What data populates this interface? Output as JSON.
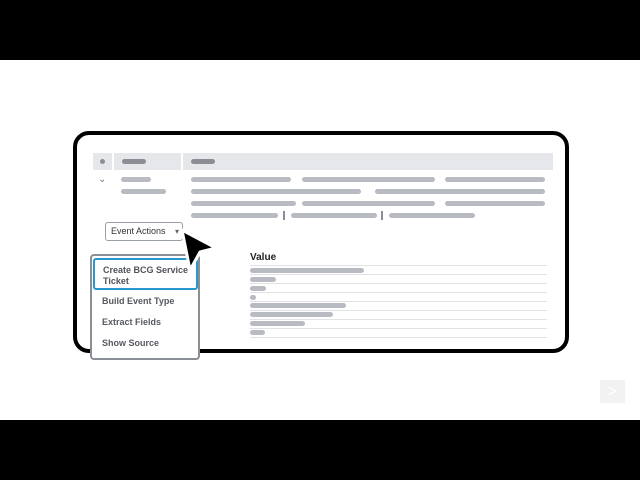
{
  "event_actions": {
    "label": "Event Actions",
    "caret_icon": "caret-down-icon"
  },
  "fields_table": {
    "value_header": "Value"
  },
  "menu": {
    "items": [
      {
        "label": "Create BCG Service Ticket",
        "highlighted": true
      },
      {
        "label": "Build Event Type"
      },
      {
        "label": "Extract Fields"
      },
      {
        "label": "Show Source"
      }
    ]
  },
  "icons": {
    "cursor": "mouse-pointer-icon",
    "next": "next-arrow-icon",
    "expand": "chevron-down-icon"
  },
  "colors": {
    "highlight": "#2a97cc",
    "placeholder_bar": "#b8bbc1"
  },
  "navigation": {
    "next_symbol": ">"
  }
}
